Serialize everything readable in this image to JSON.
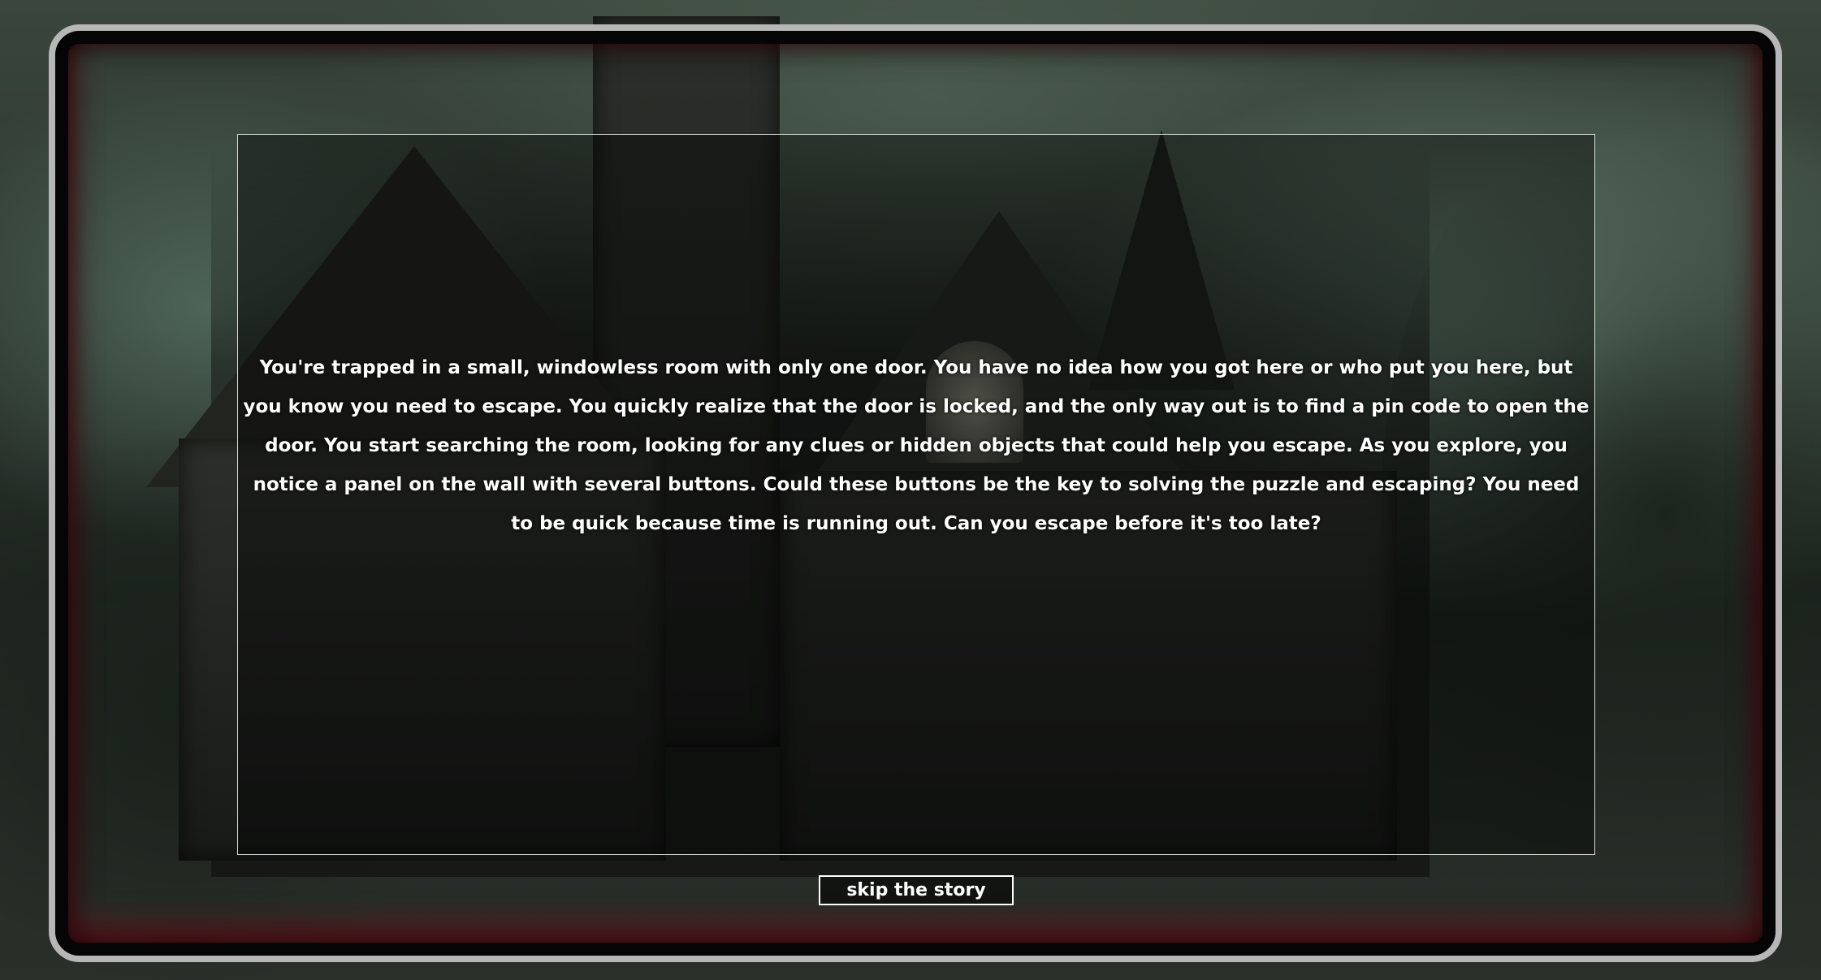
{
  "story": {
    "text": "You're trapped in a small, windowless room with only one door. You have no idea how you got here or who put you here, but you know you need to escape. You quickly realize that the door is locked, and the only way out is to find a pin code to open the door. You start searching the room, looking for any clues or hidden objects that could help you escape. As you explore, you notice a panel on the wall with several buttons. Could these buttons be the key to solving the puzzle and escaping? You need to be quick because time is running out. Can you escape before it's too late?"
  },
  "controls": {
    "skip_label": "skip the story"
  },
  "colors": {
    "frame_outer": "#b7b7b7",
    "frame_inner": "#050505",
    "frame_glow": "#aa0a1e",
    "text": "#ffffff",
    "panel_border": "#d8d8d8"
  },
  "background": {
    "icon": "haunted-mansion-image"
  }
}
